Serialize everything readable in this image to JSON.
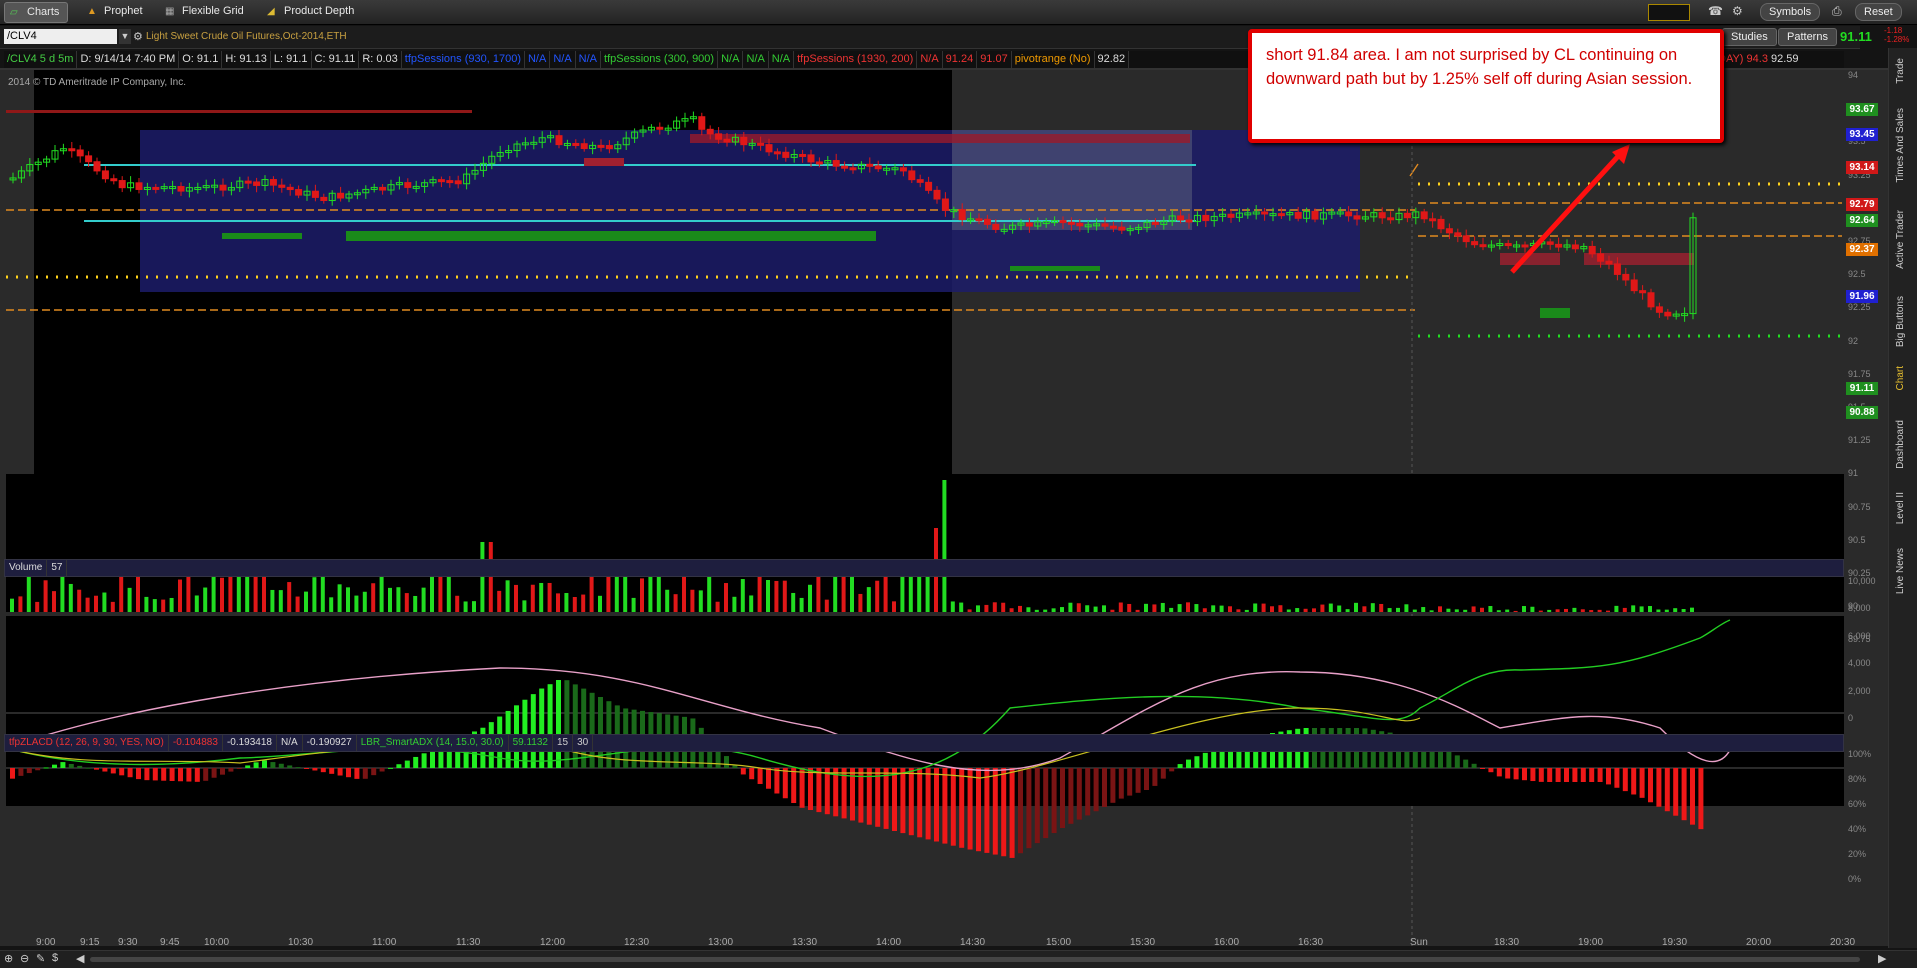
{
  "topbar": {
    "tabs": [
      {
        "label": "Charts",
        "icon": "charts-icon",
        "active": true
      },
      {
        "label": "Prophet",
        "icon": "prophet-icon"
      },
      {
        "label": "Flexible Grid",
        "icon": "grid-icon"
      },
      {
        "label": "Product Depth",
        "icon": "depth-icon"
      }
    ],
    "symbols_label": "Symbols",
    "reset_label": "Reset"
  },
  "symbol_bar": {
    "symbol": "/CLV4",
    "description": "Light Sweet Crude Oil Futures,Oct-2014,ETH",
    "studies_label": "Studies",
    "patterns_label": "Patterns",
    "last_price": "91.11",
    "change_top": "-1.18",
    "change_bottom": "-1.28%"
  },
  "status_bar": {
    "symbol_period": "/CLV4 5 d 5m",
    "date": "D: 9/14/14 7:40 PM",
    "open": "O: 91.1",
    "high": "H: 91.13",
    "low": "L: 91.1",
    "close": "C: 91.11",
    "range": "R: 0.03",
    "study1": "tfpSessions (930, 1700)",
    "na1": "N/A",
    "na2": "N/A",
    "na3": "N/A",
    "study2": "tfpSessions (300, 900)",
    "na4": "N/A",
    "na5": "N/A",
    "na6": "N/A",
    "study3": "tfpSessions (1930, 200)",
    "na7": "N/A",
    "v1": "91.24",
    "v2": "91.07",
    "study4": "pivotrange (No)",
    "v3": "92.82",
    "tail1": "DAY)",
    "tail2": "94.3",
    "tail3": "92.59"
  },
  "copyright": "2014 © TD Ameritrade IP Company, Inc.",
  "callout_text": "short 91.84 area. I am not surprised by CL continuing on downward path but by 1.25% self off during Asian session.",
  "price_tags": [
    {
      "value": "93.67",
      "color": "#1f8f1f"
    },
    {
      "value": "93.45",
      "color": "#2020d0"
    },
    {
      "value": "93.14",
      "color": "#d01818"
    },
    {
      "value": "92.79",
      "color": "#d01818"
    },
    {
      "value": "92.64",
      "color": "#1f8f1f"
    },
    {
      "value": "92.37",
      "color": "#e07000"
    },
    {
      "value": "91.96",
      "color": "#2020d0"
    },
    {
      "value": "91.11",
      "color": "#1f8f1f"
    },
    {
      "value": "90.88",
      "color": "#1f8f1f"
    }
  ],
  "price_axis": [
    "94",
    "93.75",
    "93.5",
    "93.25",
    "93",
    "92.75",
    "92.5",
    "92.25",
    "92",
    "91.75",
    "91.5",
    "91.25",
    "91",
    "90.75",
    "90.5",
    "90.25",
    "90",
    "89.75"
  ],
  "volume": {
    "label": "Volume",
    "value": "57",
    "axis": [
      "10,000",
      "8,000",
      "6,000",
      "4,000",
      "2,000",
      "0"
    ]
  },
  "lower_study": {
    "name": "tfpZLACD (12, 26, 9, 30, YES, NO)",
    "v1": "-0.104883",
    "v2": "-0.193418",
    "na": "N/A",
    "v3": "-0.190927",
    "adx_name": "LBR_SmartADX (14, 15.0, 30.0)",
    "adx_val": "59.1132",
    "p1": "15",
    "p2": "30",
    "axis": [
      "100%",
      "80%",
      "60%",
      "40%",
      "20%",
      "0%"
    ]
  },
  "time_axis": [
    "9:00",
    "9:15",
    "9:30",
    "9:45",
    "10:00",
    "10:30",
    "11:00",
    "11:30",
    "12:00",
    "12:30",
    "13:00",
    "13:30",
    "14:00",
    "14:30",
    "15:00",
    "15:30",
    "16:00",
    "16:30",
    "Sun",
    "18:30",
    "19:00",
    "19:30",
    "20:00",
    "20:30"
  ],
  "right_tabs": [
    "Trade",
    "Times And Sales",
    "Active Trader",
    "Big Buttons",
    "Chart",
    "Dashboard",
    "Level II",
    "Live News"
  ],
  "colors": {
    "up": "#22dd22",
    "down": "#e01818",
    "accent": "#e00000"
  }
}
